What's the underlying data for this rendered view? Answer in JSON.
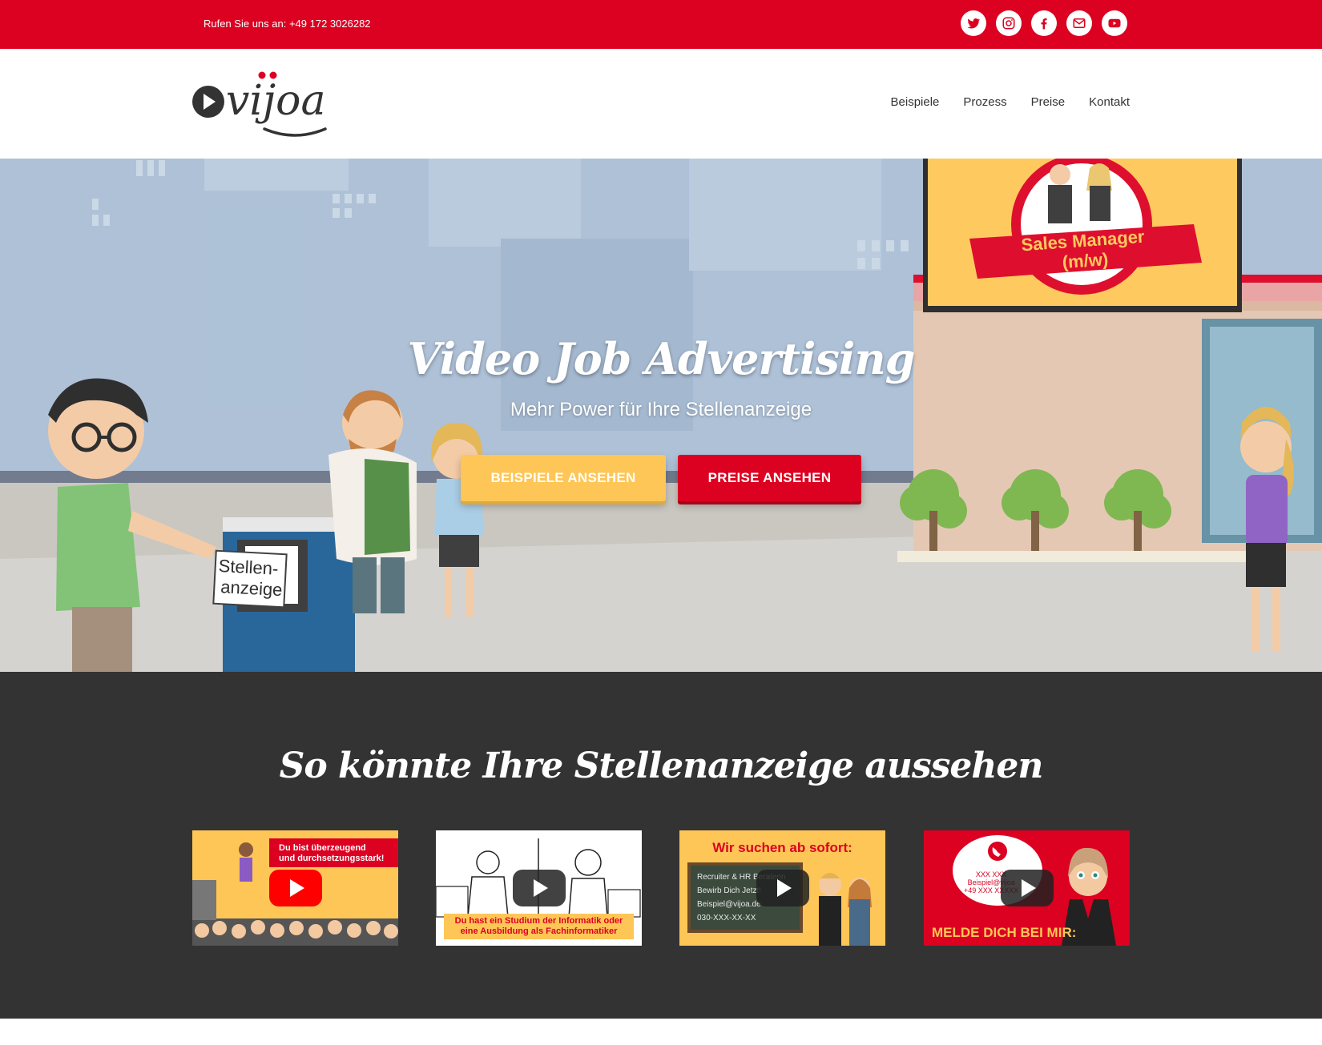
{
  "topbar": {
    "phone": "Rufen Sie uns an: +49 172 3026282",
    "social": [
      {
        "icon": "twitter-icon"
      },
      {
        "icon": "instagram-icon"
      },
      {
        "icon": "facebook-icon"
      },
      {
        "icon": "mail-icon"
      },
      {
        "icon": "youtube-icon"
      }
    ],
    "color": "#dc0021"
  },
  "header": {
    "logo_text": "vijoa",
    "nav": [
      "Beispiele",
      "Prozess",
      "Preise",
      "Kontakt"
    ]
  },
  "hero": {
    "title": "Video Job Advertising",
    "subtitle": "Mehr Power für Ihre Stellenanzeige",
    "btn_examples": "BEISPIELE ANSEHEN",
    "btn_prices": "PREISE ANSEHEN",
    "illustration_sign": "Stellen-\nanzeige",
    "illustration_sign_line1": "Stellen-",
    "illustration_sign_line2": "anzeige",
    "billboard_line1": "Sales Manager",
    "billboard_line2": "(m/w)"
  },
  "examples": {
    "title": "So könnte Ihre Stellenanzeige aussehen",
    "videos": [
      {
        "caption_line1": "Du bist überzeugend",
        "caption_line2": "und durchsetzungsstark!"
      },
      {
        "caption_line1": "Du hast ein Studium der Informatik oder",
        "caption_line2": "eine Ausbildung als Fachinformatiker"
      },
      {
        "caption_title": "Wir suchen ab sofort:",
        "board_lines": [
          "Recruiter & HR Beraterin",
          "Bewirb Dich Jetzt!",
          "Beispiel@vijoa.de",
          "030-XXX-XX-XX"
        ]
      },
      {
        "bubble_lines": [
          "XXX XXX",
          "Beispiel@vijoa",
          "+49 XXX XXXXX"
        ],
        "caption": "MELDE DICH BEI MIR:"
      }
    ]
  },
  "colors": {
    "brand_red": "#dc0021",
    "yellow": "#fec656",
    "dark": "#333333"
  }
}
